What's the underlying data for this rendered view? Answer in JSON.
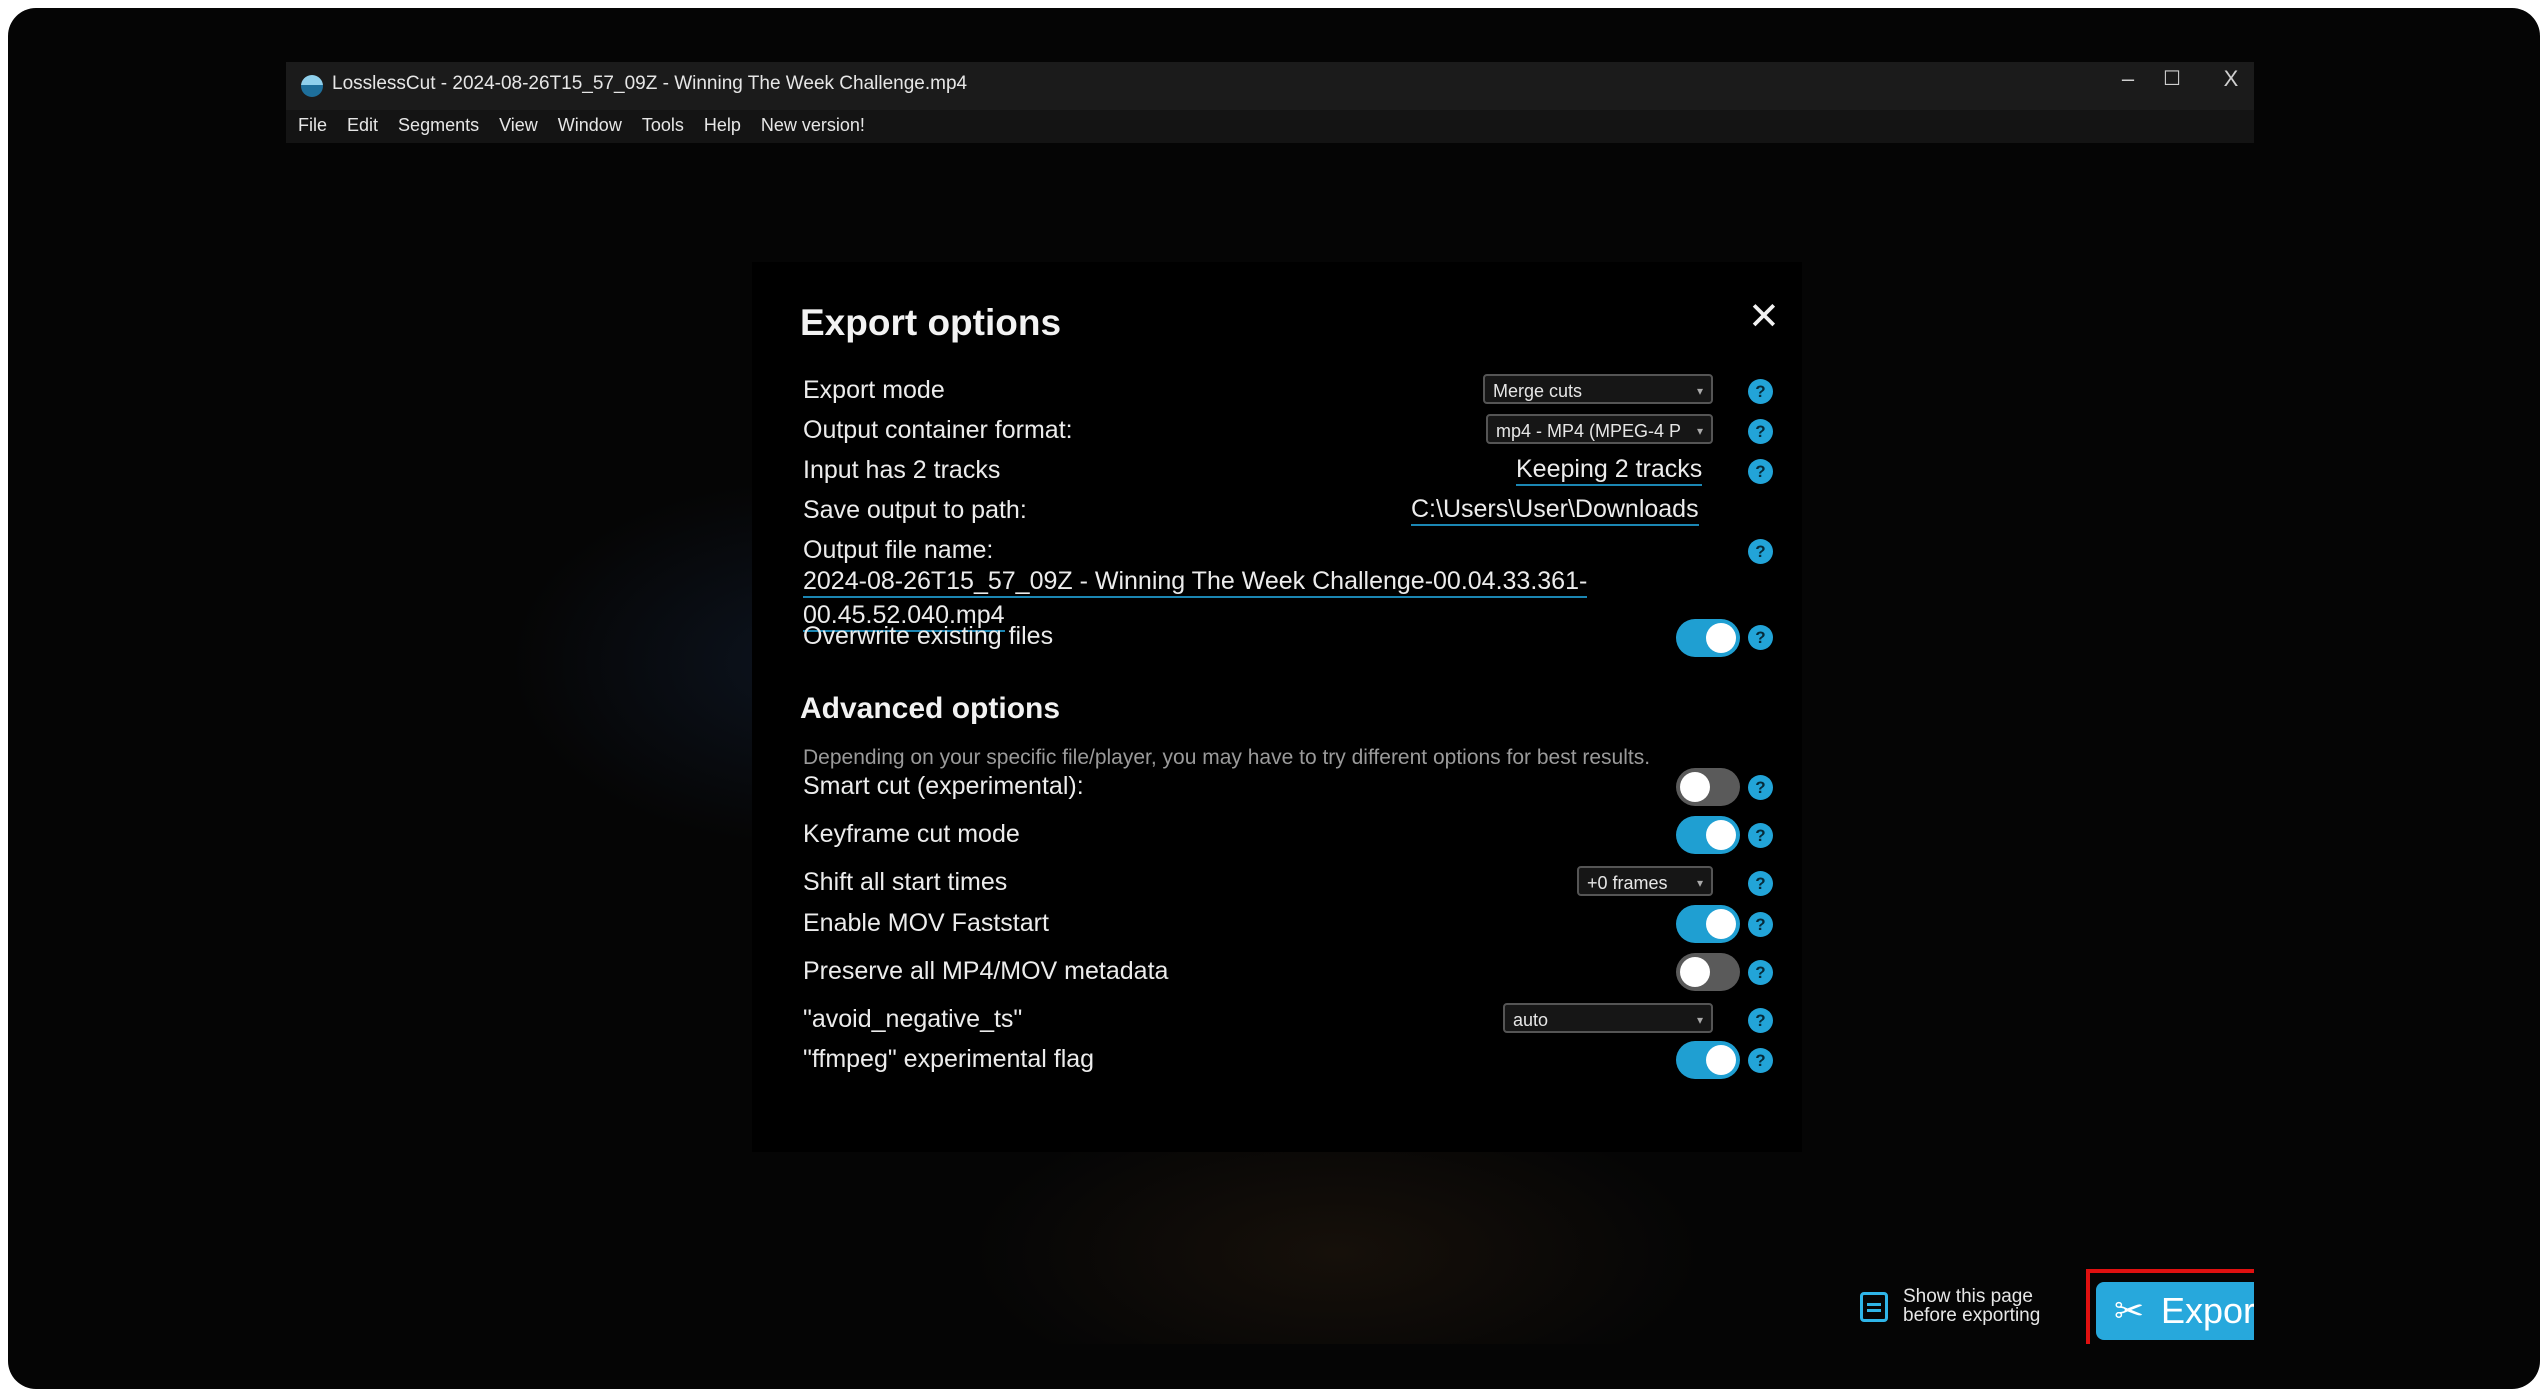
{
  "window": {
    "title": "LosslessCut - 2024-08-26T15_57_09Z - Winning The Week Challenge.mp4",
    "controls": {
      "minimize": "–",
      "maximize": "☐",
      "close": "X"
    }
  },
  "menu": [
    "File",
    "Edit",
    "Segments",
    "View",
    "Window",
    "Tools",
    "Help",
    "New version!"
  ],
  "dialog": {
    "title": "Export options",
    "close_icon": "✕",
    "rows": {
      "export_mode": {
        "label": "Export mode",
        "value": "Merge cuts"
      },
      "container": {
        "label": "Output container format:",
        "value": "mp4 - MP4 (MPEG-4 P"
      },
      "tracks": {
        "label": "Input has 2 tracks",
        "value": "Keeping 2 tracks"
      },
      "path": {
        "label": "Save output to path:",
        "value": "C:\\Users\\User\\Downloads"
      },
      "filename": {
        "label": "Output file name:",
        "line1": "2024-08-26T15_57_09Z - Winning The Week Challenge-00.04.33.361-",
        "line2": "00.45.52.040.mp4"
      },
      "overwrite": {
        "label": "Overwrite existing files",
        "on": true
      }
    },
    "advanced": {
      "title": "Advanced options",
      "note": "Depending on your specific file/player, you may have to try different options for best results.",
      "smart_cut": {
        "label": "Smart cut (experimental):",
        "on": false
      },
      "keyframe": {
        "label": "Keyframe cut mode",
        "on": true
      },
      "shift": {
        "label": "Shift all start times",
        "value": "+0 frames"
      },
      "faststart": {
        "label": "Enable MOV Faststart",
        "on": true
      },
      "preserve": {
        "label": "Preserve all MP4/MOV metadata",
        "on": false
      },
      "avoid_neg": {
        "label": "\"avoid_negative_ts\"",
        "value": "auto"
      },
      "ffmpeg_flag": {
        "label": "\"ffmpeg\" experimental flag",
        "on": true
      }
    },
    "help_glyph": "?"
  },
  "footer": {
    "show_page_line1": "Show this page",
    "show_page_line2": "before exporting",
    "export_label": "Expor",
    "export_icon": "scissors-icon"
  },
  "colors": {
    "accent": "#27a8dc",
    "highlight": "#e01010"
  }
}
